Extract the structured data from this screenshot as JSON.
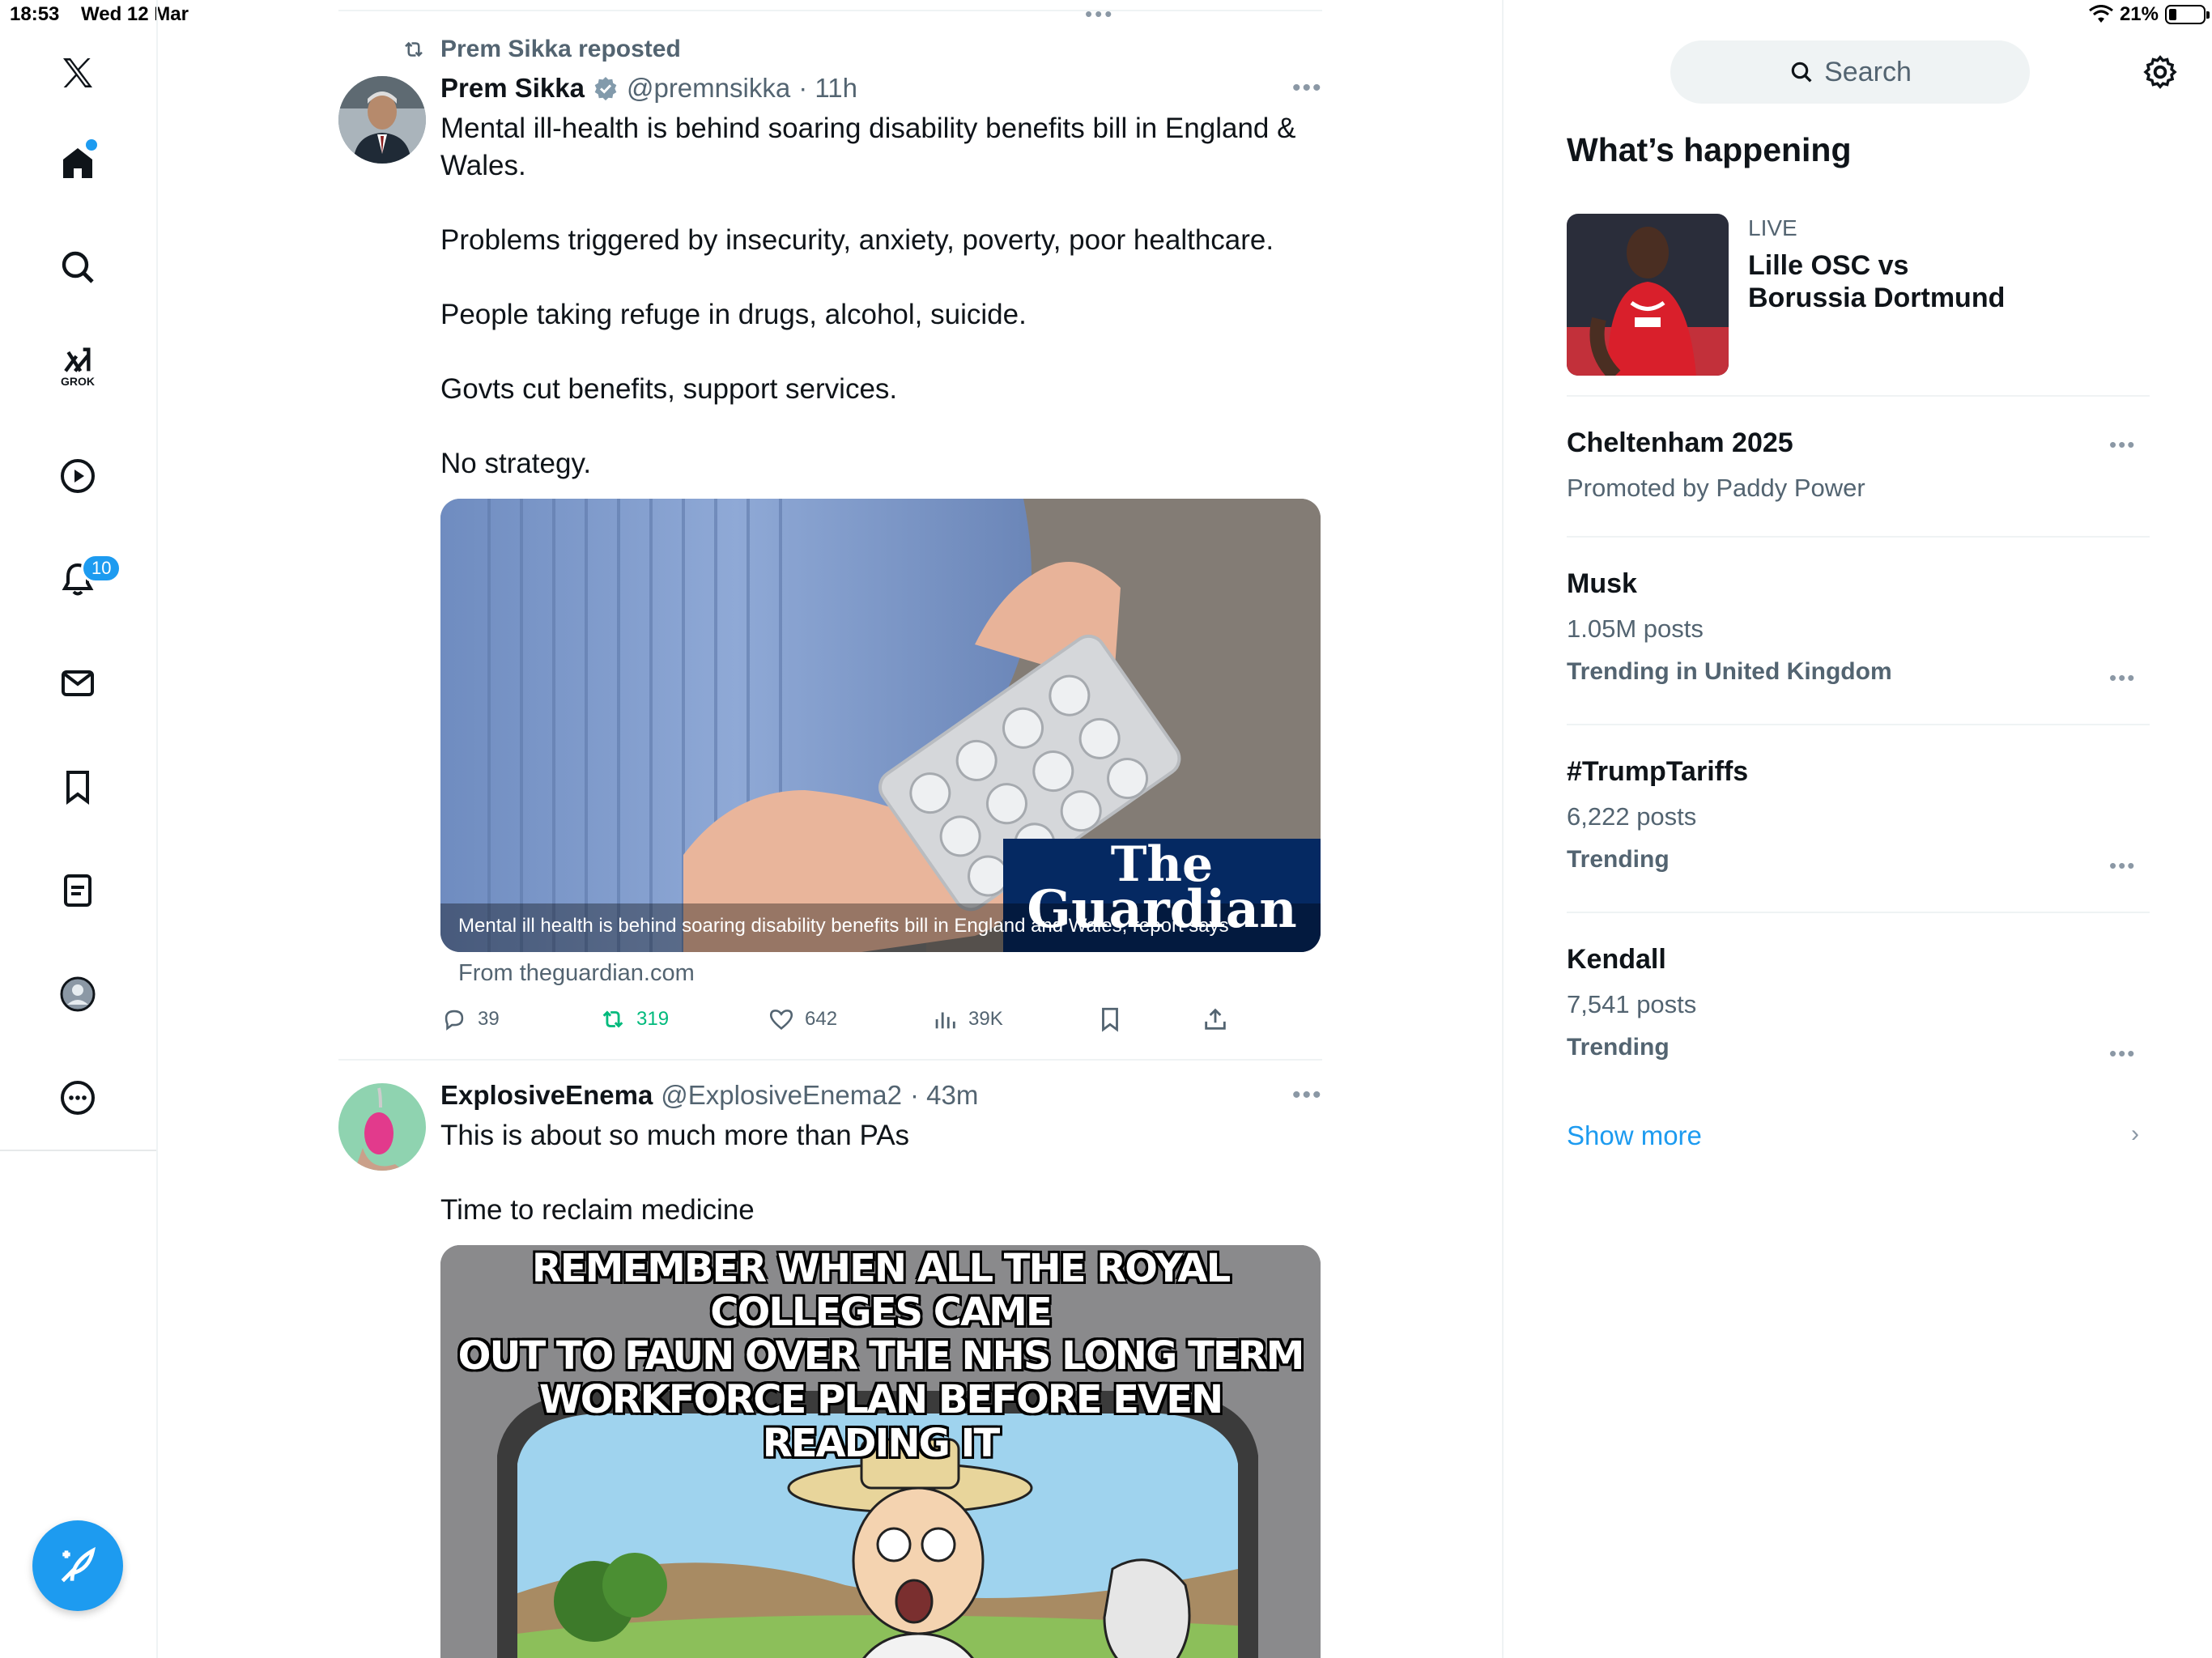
{
  "status_bar": {
    "time": "18:53",
    "date": "Wed 12 Mar",
    "battery": "21%"
  },
  "nav": {
    "notification_count": "10",
    "grok_label": "GROK",
    "items": [
      "home",
      "explore",
      "grok",
      "video",
      "notifications",
      "messages",
      "bookmarks",
      "lists",
      "profile",
      "more"
    ]
  },
  "feed": {
    "top_dots": "•••",
    "tweet1": {
      "repost_label": "Prem Sikka reposted",
      "name": "Prem Sikka",
      "handle": "@premnsikka",
      "time": "· 11h",
      "more": "•••",
      "paragraphs": [
        "Mental ill-health is behind soaring disability benefits bill in England & Wales.",
        "Problems triggered by insecurity, anxiety, poverty, poor healthcare.",
        "People taking refuge in drugs, alcohol, suicide.",
        "Govts cut benefits, support services.",
        "No strategy."
      ],
      "card_caption": "Mental ill health is behind soaring disability benefits bill in England and Wales, report says",
      "card_logo_line1": "The",
      "card_logo_line2": "Guardian",
      "card_source": "From theguardian.com",
      "replies": "39",
      "reposts": "319",
      "likes": "642",
      "views": "39K"
    },
    "tweet2": {
      "name": "ExplosiveEnema",
      "handle": "@ExplosiveEnema2",
      "time": "· 43m",
      "more": "•••",
      "paragraphs": [
        "This is about so much more than PAs",
        "Time to reclaim medicine"
      ],
      "meme_lines": [
        "REMEMBER WHEN ALL THE ROYAL COLLEGES CAME",
        "OUT TO FAUN OVER THE NHS LONG TERM",
        "WORKFORCE PLAN BEFORE EVEN READING IT"
      ]
    }
  },
  "sidebar": {
    "search_placeholder": "Search",
    "heading": "What’s happening",
    "live": {
      "label": "LIVE",
      "title_line1": "Lille OSC vs",
      "title_line2": "Borussia Dortmund"
    },
    "trends": [
      {
        "title": "Cheltenham 2025",
        "sub": "Promoted by Paddy Power",
        "meta": ""
      },
      {
        "title": "Musk",
        "sub": "1.05M posts",
        "meta": "Trending in United Kingdom"
      },
      {
        "title": "#TrumpTariffs",
        "sub": "6,222 posts",
        "meta": "Trending"
      },
      {
        "title": "Kendall",
        "sub": "7,541 posts",
        "meta": "Trending"
      }
    ],
    "show_more": "Show more",
    "more_dots": "•••"
  },
  "colors": {
    "accent": "#1d9bf0",
    "repost_green": "#00ba7c",
    "text": "#0f1419",
    "muted": "#536471"
  }
}
